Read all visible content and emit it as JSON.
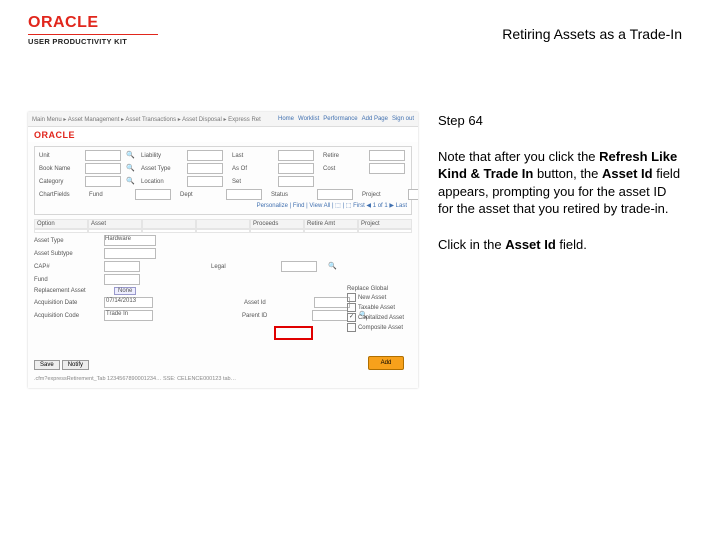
{
  "header": {
    "brand_word": "ORACLE",
    "brand_sub": "USER PRODUCTIVITY KIT",
    "doc_title": "Retiring Assets as a Trade-In"
  },
  "instructions": {
    "step_label": "Step 64",
    "para1_pre": "Note that after you click the ",
    "para1_b1": "Refresh Like Kind & Trade In",
    "para1_mid1": " button, the ",
    "para1_b2": "Asset Id",
    "para1_mid2": " field appears, prompting you for the asset ID for the asset that you retired by trade-in.",
    "para2_pre": "Click in the ",
    "para2_b1": "Asset Id",
    "para2_post": " field."
  },
  "shot": {
    "top_menu": "Main Menu  ▸  Asset Management  ▸  Asset Transactions  ▸  Asset Disposal  ▸  Express Ret",
    "top_links": [
      "Home",
      "Worklist",
      "Performance",
      "Add Page",
      "Sign out"
    ],
    "shot_brand": "ORACLE",
    "filters_labels": [
      "Unit",
      "Book Name",
      "Category",
      "ChartFields"
    ],
    "filters2": [
      "Liability",
      "Asset Type",
      "Location",
      "Dept"
    ],
    "filters3": [
      "Last",
      "As Of",
      "Fund",
      "Status"
    ],
    "filters4": [
      "Retire",
      "",
      "Cost",
      "Set"
    ],
    "filters5": [
      "",
      "",
      "",
      "Project"
    ],
    "pager": "Personalize | Find | View All | ⬚ | ⬚   First ◀ 1 of 1 ▶ Last",
    "grid_headers": [
      "Option",
      "Asset",
      "",
      "",
      "Proceeds",
      "Retire Amt",
      "Project"
    ],
    "grid_cells": [
      "",
      "",
      "",
      "",
      "",
      "",
      ""
    ],
    "section": {
      "asset_type": "Asset Type",
      "asset_type_val": "Hardware",
      "asset_subtype": "Asset Subtype",
      "cap#": "CAP#",
      "fund": "Fund",
      "acq_date": "Acquisition Date",
      "acq_date_val": "07/14/2013",
      "acq_code": "Acquisition Code",
      "acq_code_val": "Trade In",
      "replace_asset": "Replacement Asset",
      "replace_asset_val": "None",
      "legal": "Legal",
      "asset_id_lbl": "Asset Id",
      "parent_id_lbl": "Parent ID"
    },
    "checks": {
      "title": "Replace Global",
      "c1": "New Asset",
      "c2": "Taxable Asset",
      "c3": "Capitalized Asset",
      "c4": "Composite Asset"
    },
    "btn_save": "Save",
    "btn_notify": "Notify",
    "orange_btn": "Add",
    "footer": ".cfm?expressRetirement_Tab   1234567890001234…   SSE:  CELENCE000123  tab…"
  }
}
